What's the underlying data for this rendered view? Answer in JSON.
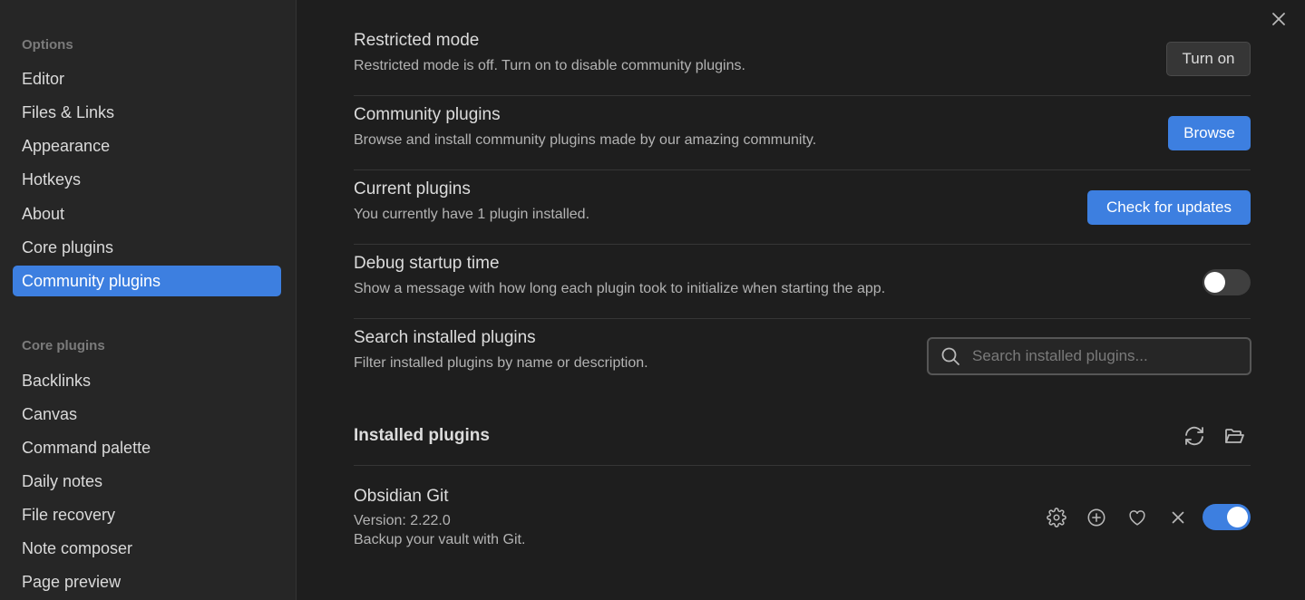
{
  "sidebar": {
    "options_title": "Options",
    "options_items": [
      {
        "label": "Editor"
      },
      {
        "label": "Files & Links"
      },
      {
        "label": "Appearance"
      },
      {
        "label": "Hotkeys"
      },
      {
        "label": "About"
      },
      {
        "label": "Core plugins"
      },
      {
        "label": "Community plugins",
        "active": true
      }
    ],
    "core_title": "Core plugins",
    "core_items": [
      {
        "label": "Backlinks"
      },
      {
        "label": "Canvas"
      },
      {
        "label": "Command palette"
      },
      {
        "label": "Daily notes"
      },
      {
        "label": "File recovery"
      },
      {
        "label": "Note composer"
      },
      {
        "label": "Page preview"
      }
    ]
  },
  "settings": {
    "restricted": {
      "name": "Restricted mode",
      "desc": "Restricted mode is off. Turn on to disable community plugins.",
      "button": "Turn on"
    },
    "community": {
      "name": "Community plugins",
      "desc": "Browse and install community plugins made by our amazing community.",
      "button": "Browse"
    },
    "current": {
      "name": "Current plugins",
      "desc": "You currently have 1 plugin installed.",
      "button": "Check for updates"
    },
    "debug": {
      "name": "Debug startup time",
      "desc": "Show a message with how long each plugin took to initialize when starting the app.",
      "toggle_on": false
    },
    "search": {
      "name": "Search installed plugins",
      "desc": "Filter installed plugins by name or description.",
      "placeholder": "Search installed plugins...",
      "value": ""
    }
  },
  "installed": {
    "title": "Installed plugins",
    "plugins": [
      {
        "name": "Obsidian Git",
        "version": "Version: 2.22.0",
        "desc": "Backup your vault with Git.",
        "enabled": true
      }
    ]
  },
  "icons": {
    "close": "close-icon",
    "reload": "reload-icon",
    "folder": "folder-open-icon",
    "gear": "gear-icon",
    "plus": "plus-circle-icon",
    "heart": "heart-icon",
    "x": "x-icon",
    "search": "search-icon"
  },
  "colors": {
    "accent": "#3d7fe0",
    "background": "#1e1e1e",
    "sidebar": "#262626"
  }
}
